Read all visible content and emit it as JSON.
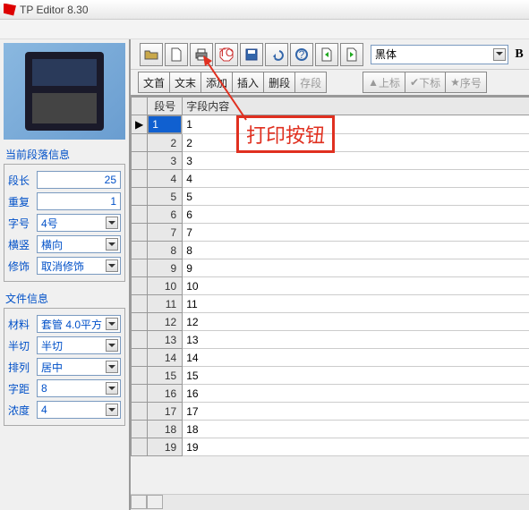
{
  "app": {
    "title": "TP Editor  8.30"
  },
  "panels": {
    "paragraph": {
      "title": "当前段落信息",
      "rows": {
        "length": {
          "label": "段长",
          "value": "25"
        },
        "repeat": {
          "label": "重复",
          "value": "1"
        },
        "font": {
          "label": "字号",
          "value": "4号"
        },
        "orient": {
          "label": "横竖",
          "value": "横向"
        },
        "decor": {
          "label": "修饰",
          "value": "取消修饰"
        }
      }
    },
    "file": {
      "title": "文件信息",
      "rows": {
        "material": {
          "label": "材料",
          "value": "套管 4.0平方"
        },
        "cut": {
          "label": "半切",
          "value": "半切"
        },
        "align": {
          "label": "排列",
          "value": "居中"
        },
        "spacing": {
          "label": "字距",
          "value": "8"
        },
        "density": {
          "label": "浓度",
          "value": "4"
        }
      }
    }
  },
  "toolbar2": {
    "b1": "文首",
    "b2": "文末",
    "b3": "添加",
    "b4": "插入",
    "b5": "删段",
    "b6": "存段",
    "sup": "上标",
    "sub": "下标",
    "order": "序号"
  },
  "font": {
    "value": "黑体",
    "bold": "B"
  },
  "grid": {
    "col1": "段号",
    "col2": "字段内容",
    "rows": [
      {
        "n": "1",
        "c": "1"
      },
      {
        "n": "2",
        "c": "2"
      },
      {
        "n": "3",
        "c": "3"
      },
      {
        "n": "4",
        "c": "4"
      },
      {
        "n": "5",
        "c": "5"
      },
      {
        "n": "6",
        "c": "6"
      },
      {
        "n": "7",
        "c": "7"
      },
      {
        "n": "8",
        "c": "8"
      },
      {
        "n": "9",
        "c": "9"
      },
      {
        "n": "10",
        "c": "10"
      },
      {
        "n": "11",
        "c": "11"
      },
      {
        "n": "12",
        "c": "12"
      },
      {
        "n": "13",
        "c": "13"
      },
      {
        "n": "14",
        "c": "14"
      },
      {
        "n": "15",
        "c": "15"
      },
      {
        "n": "16",
        "c": "16"
      },
      {
        "n": "17",
        "c": "17"
      },
      {
        "n": "18",
        "c": "18"
      },
      {
        "n": "19",
        "c": "19"
      }
    ]
  },
  "annotation": {
    "label": "打印按钮"
  }
}
